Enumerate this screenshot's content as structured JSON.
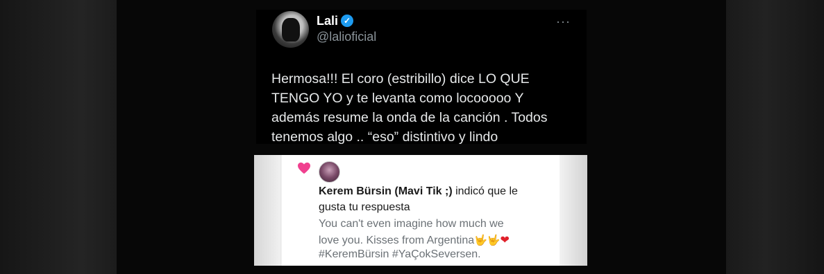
{
  "tweet": {
    "name": "Lali",
    "handle": "@lalioficial",
    "more": "···",
    "lines": [
      "Hermosa!!! El coro (estribillo) dice LO QUE",
      "TENGO YO y te levanta como locooooo Y",
      "además resume la onda de la canción . Todos",
      "tenemos algo .. “eso” distintivo y lindo"
    ]
  },
  "notification": {
    "user": "Kerem Bürsin (Mavi Tik ;)",
    "action_1": " indicó que le",
    "action_2": "gusta tu respuesta",
    "reply_1": "You can't even imagine how much we",
    "reply_2": "love you. Kisses from Argentina",
    "reply_emojis": "🤟🤟",
    "reply_heart": "❤",
    "reply_3": "#KeremBürsin #YaÇokSeversen."
  },
  "colors": {
    "verified": "#1d9bf0",
    "like_heart": "#f0408f"
  }
}
